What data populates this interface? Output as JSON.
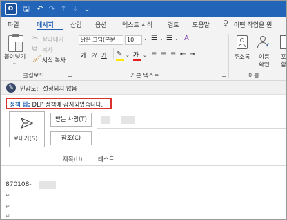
{
  "quick_access": {
    "app_logo": "O",
    "save": "🖫",
    "undo": "↶",
    "redo": "↷",
    "up": "↑",
    "down": "↓",
    "customize": "⌄"
  },
  "menu": {
    "tabs": [
      "파일",
      "메시지",
      "삽입",
      "옵션",
      "텍스트 서식",
      "검토",
      "도움말"
    ],
    "active_tab": "메시지",
    "tell_me": "어떤 작업을 원"
  },
  "ribbon": {
    "clipboard": {
      "paste_label": "붙여넣기",
      "cut_label": "잘라내기",
      "copy_label": "복사",
      "format_painter_label": "서식 복사",
      "group_label": "클립보드"
    },
    "basic_text": {
      "font_name": "맑은 고딕(본문",
      "font_size": "10",
      "bold": "가",
      "italic": "가",
      "underline": "가",
      "font_color_glyph": "가",
      "group_label": "기본 텍스트"
    },
    "names": {
      "address_book_label": "주소록",
      "check_names_label_line1": "이름",
      "check_names_label_line2": "확인",
      "group_label": "이름"
    },
    "partial_label_1": "포",
    "partial_label_2": "함"
  },
  "sensitivity": {
    "label": "민감도:",
    "value": "설정되지 않음"
  },
  "policy_tip": {
    "label": "정책 팁:",
    "message": "DLP 정책에 감지되었습니다."
  },
  "compose": {
    "send_label": "보내기(S)",
    "to_button": "받는 사람(T)",
    "cc_button": "참조(C)",
    "subject_label": "제목(U)",
    "subject_value": "테스트",
    "body_line1": "870108-",
    "pilcrow": "↵"
  },
  "colors": {
    "titlebar": "#2264b8",
    "accent": "#1f5fb4",
    "policy_border": "#d9342b",
    "highlight_yellow": "#ffe600",
    "font_red": "#e02020"
  }
}
